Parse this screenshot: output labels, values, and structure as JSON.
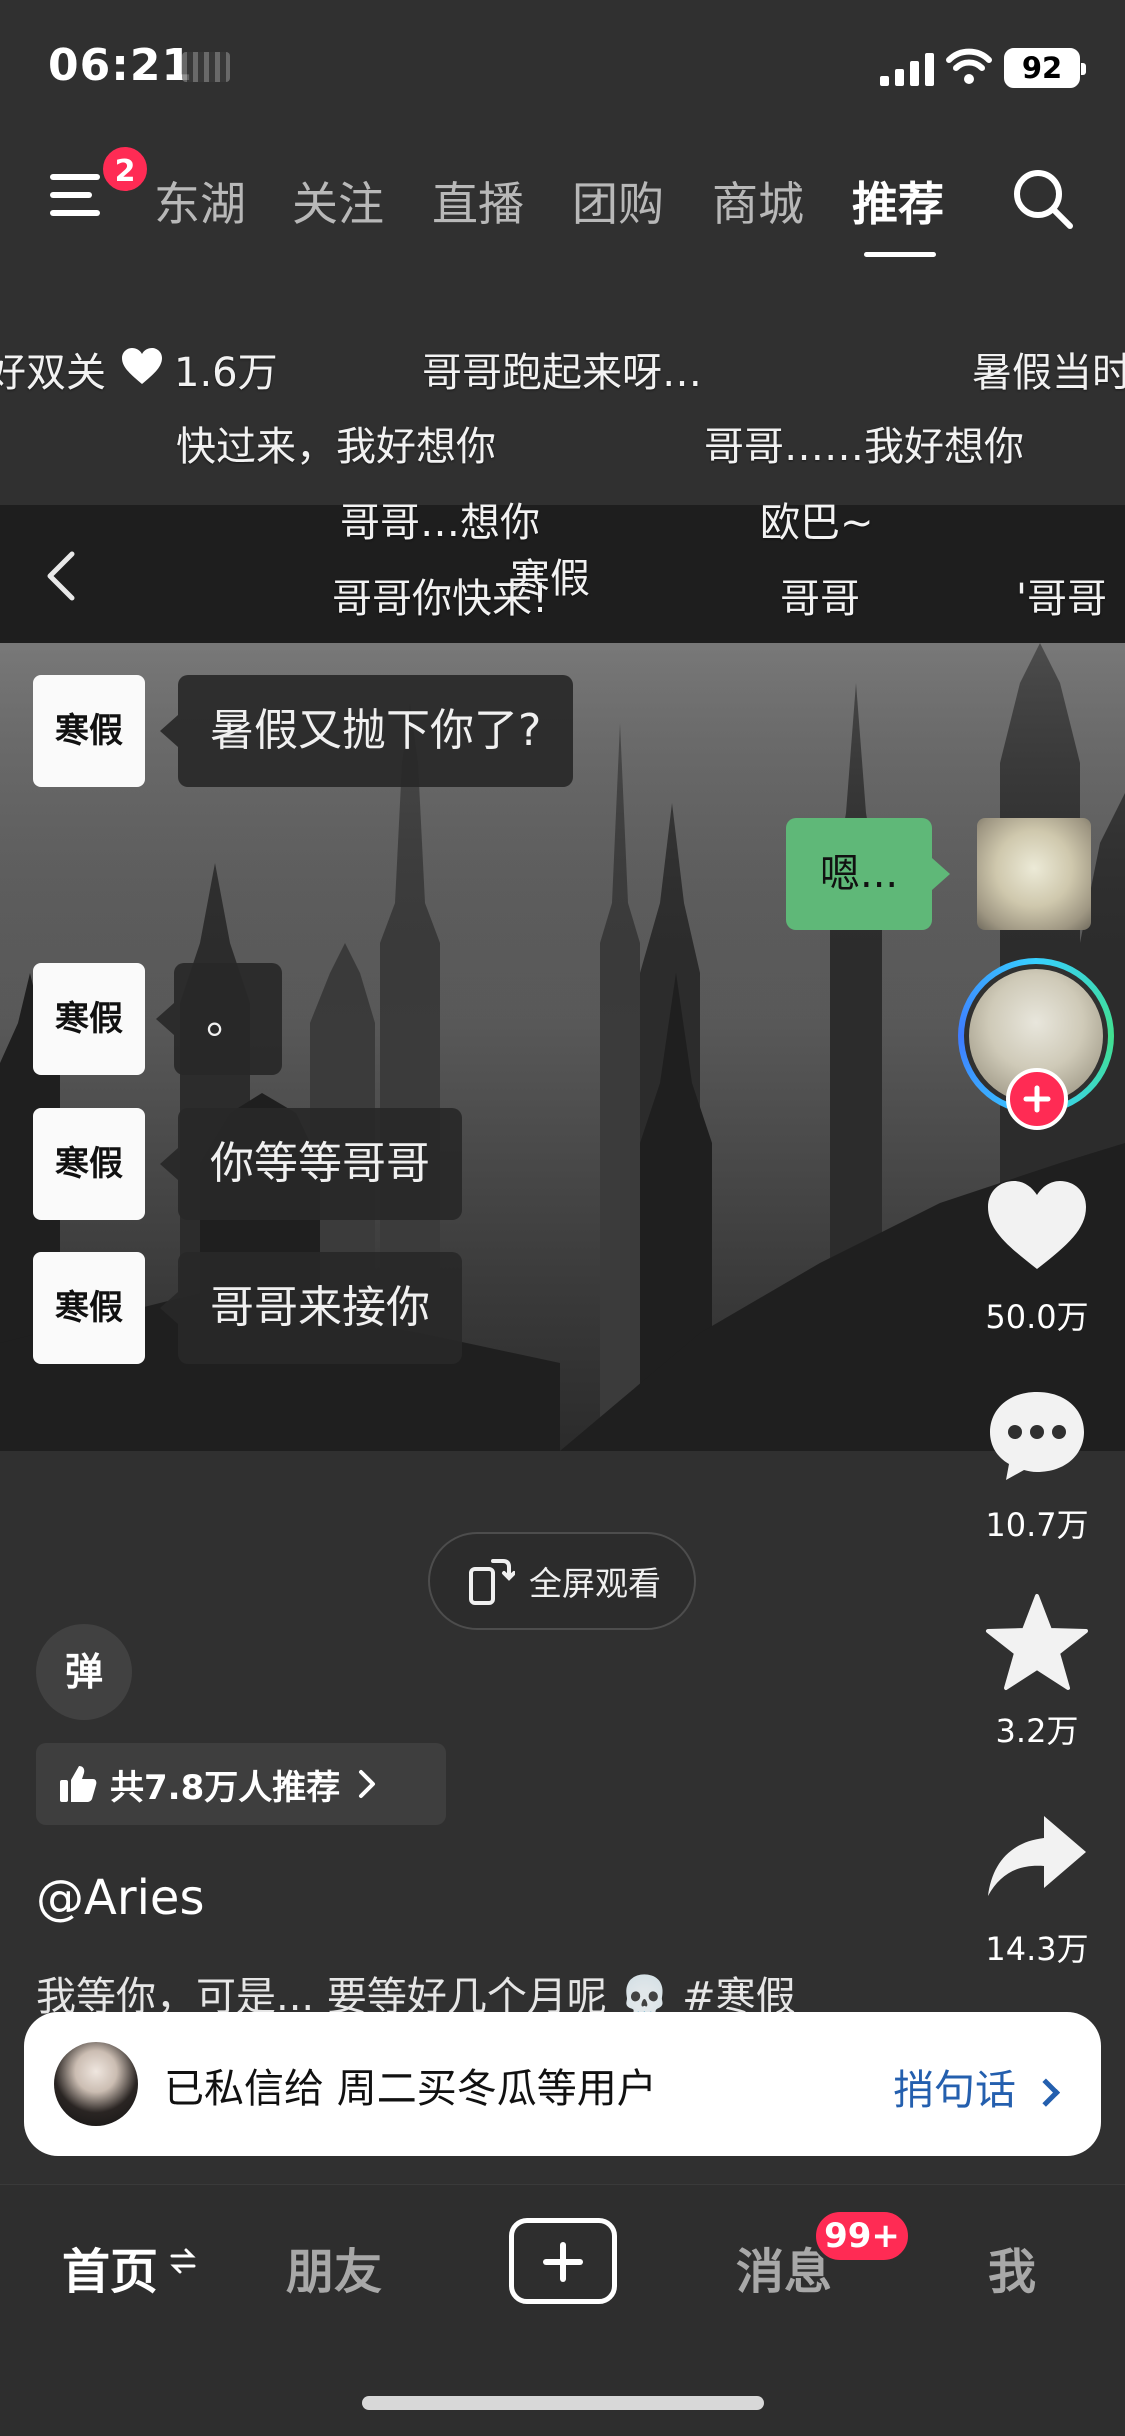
{
  "status_bar": {
    "time": "06:21",
    "battery": "92"
  },
  "top_nav": {
    "menu_badge": "2",
    "tabs": [
      {
        "label": "东湖",
        "active": false
      },
      {
        "label": "关注",
        "active": false
      },
      {
        "label": "直播",
        "active": false
      },
      {
        "label": "团购",
        "active": false
      },
      {
        "label": "商城",
        "active": false
      },
      {
        "label": "推荐",
        "active": true
      }
    ]
  },
  "danmaku": [
    "好双关",
    "1.6万",
    "哥哥跑起来呀…",
    "暑假当时",
    "快过来，我好想你",
    "哥哥……我好想你",
    "哥哥…想你",
    "欧巴~",
    "寒假",
    "哥哥你快来!",
    "哥哥",
    "'哥哥"
  ],
  "video": {
    "chat_name": "寒假",
    "messages": [
      {
        "from": "寒假",
        "text": "暑假又抛下你了?"
      },
      {
        "from": "me",
        "text": "嗯..."
      },
      {
        "from": "寒假",
        "text": "。"
      },
      {
        "from": "寒假",
        "text": "你等等哥哥"
      },
      {
        "from": "寒假",
        "text": "哥哥来接你"
      }
    ]
  },
  "right_rail": {
    "likes": "50.0万",
    "comments": "10.7万",
    "favorites": "3.2万",
    "shares": "14.3万"
  },
  "fullscreen_label": "全屏观看",
  "danmaku_toggle": "弹",
  "recommend_chip": "共7.8万人推荐",
  "author": "@Aries",
  "caption": "我等你，可是... 要等好几个月呢 💀 #寒假",
  "share_card": {
    "text": "已私信给 周二买冬瓜等用户",
    "action": "捎句话"
  },
  "bottom_nav": {
    "home": "首页",
    "friends": "朋友",
    "messages": "消息",
    "messages_badge": "99+",
    "me": "我"
  },
  "colors": {
    "accent_red": "#ff2b54",
    "green_bubble": "#5fb878",
    "link_blue": "#245fae"
  }
}
